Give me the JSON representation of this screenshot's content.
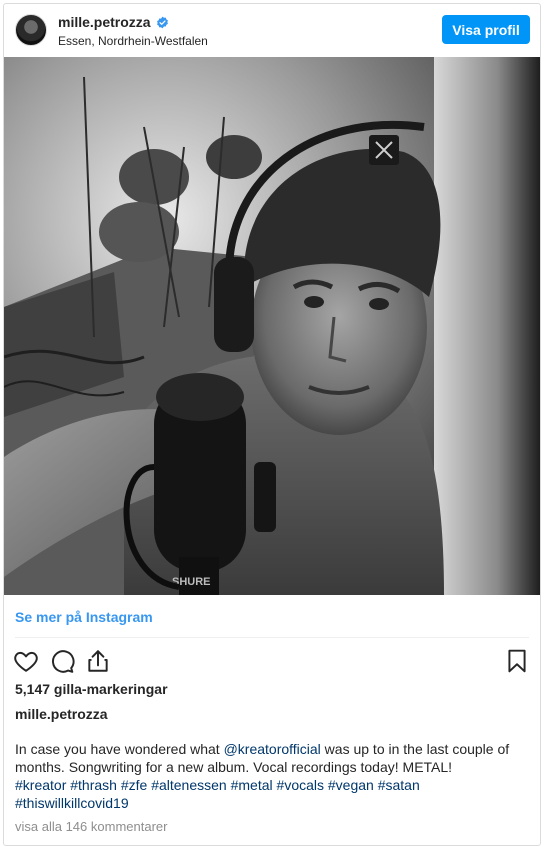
{
  "post": {
    "username": "mille.petrozza",
    "location": "Essen, Nordrhein-Westfalen",
    "profile_button": "Visa profil",
    "verified_icon": "verified-badge-icon",
    "see_more_link": "Se mer på Instagram",
    "likes": "5,147 gilla-markeringar",
    "caption_username": "mille.petrozza",
    "caption": {
      "before_mention": "In case you have wondered what ",
      "mention": "@kreatorofficial",
      "after_mention": " was up to in the last couple of months. Songwriting for a new album. Vocal recordings today! METAL!",
      "hashtags": [
        "#kreator",
        "#thrash",
        "#zfe",
        "#altenessen",
        "#metal",
        "#vocals",
        "#vegan",
        "#satan",
        "#thiswillkillcovid19"
      ]
    },
    "view_comments": "visa alla 146 kommentarer",
    "icons": {
      "like": "heart-icon",
      "comment": "comment-bubble-icon",
      "share": "share-icon",
      "save": "bookmark-icon"
    },
    "colors": {
      "accent": "#0095f6",
      "link": "#3897f0",
      "hashtag": "#00376b",
      "muted": "#8e8e8e"
    }
  }
}
